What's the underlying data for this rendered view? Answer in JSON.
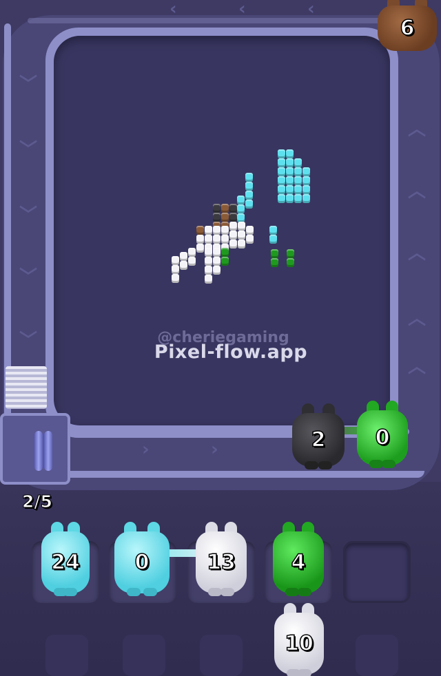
{
  "game": {
    "title": "Pixel Flow",
    "watermark_handle": "@cheriegaming",
    "watermark_site": "Pixel-flow.app",
    "slot_indicator": "2/5",
    "colors": {
      "background": "#3e3a63",
      "track": "#8e8fc9",
      "cyan": "#6ee3ee",
      "white": "#f4f4f8",
      "green": "#2ec12e",
      "black": "#3a3a3e",
      "brown": "#7a4a2c"
    }
  },
  "conveyor_units": [
    {
      "id": "brown",
      "color": "brown",
      "count": "6"
    },
    {
      "id": "black",
      "color": "black",
      "count": "2"
    },
    {
      "id": "green",
      "color": "green",
      "count": "0"
    }
  ],
  "slots": [
    {
      "color": "cyan",
      "count": "24"
    },
    {
      "color": "cyan",
      "count": "0"
    },
    {
      "color": "white",
      "count": "13"
    },
    {
      "color": "green",
      "count": "4"
    },
    {
      "color": null,
      "count": null
    }
  ],
  "queue": [
    {
      "color": "white",
      "count": "10"
    }
  ]
}
